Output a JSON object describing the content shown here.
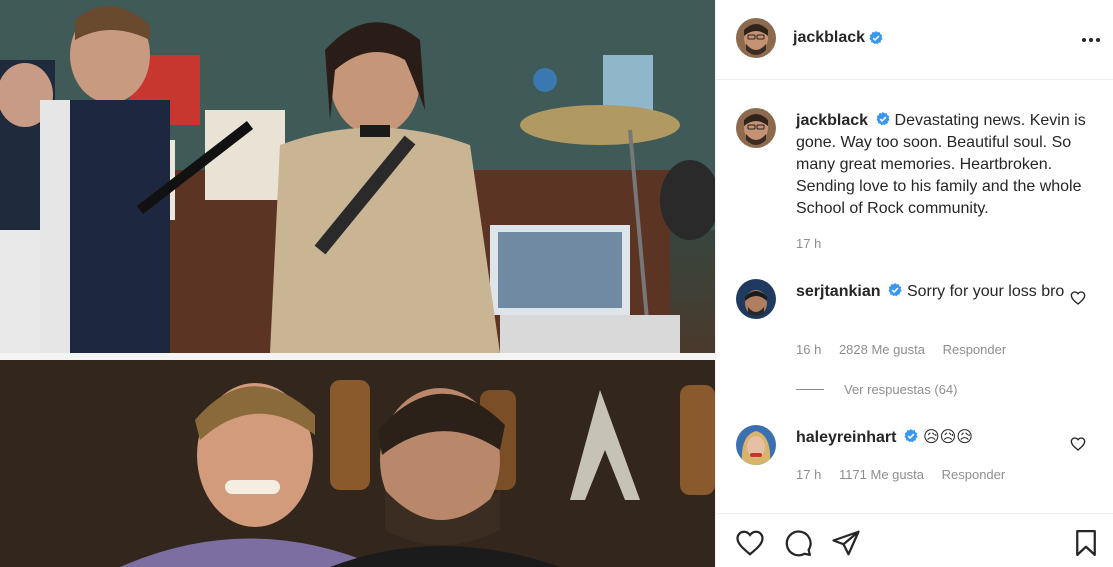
{
  "post": {
    "author": "jackblack",
    "more_icon": "more-horizontal-icon",
    "verified_icon": "verified-badge-icon"
  },
  "caption": {
    "username": "jackblack",
    "text": "Devastating news. Kevin is gone. Way too soon. Beautiful soul. So many great memories. Heartbroken. Sending love to his family and the whole School of Rock community.",
    "time": "17 h"
  },
  "comments": [
    {
      "username": "serjtankian",
      "text": "Sorry for your loss bro",
      "time": "16 h",
      "likes": "2828 Me gusta",
      "reply_label": "Responder",
      "view_replies": "Ver respuestas (64)"
    },
    {
      "username": "haleyreinhart",
      "text": "😥😥😥",
      "time": "17 h",
      "likes": "1171 Me gusta",
      "reply_label": "Responder"
    }
  ],
  "actions": {
    "like_icon": "heart-icon",
    "comment_icon": "comment-icon",
    "share_icon": "paper-plane-icon",
    "save_icon": "bookmark-icon"
  },
  "colors": {
    "verified": "#3897f0",
    "text": "#262626",
    "secondary_text": "#8e8e8e",
    "border": "#efefef"
  }
}
